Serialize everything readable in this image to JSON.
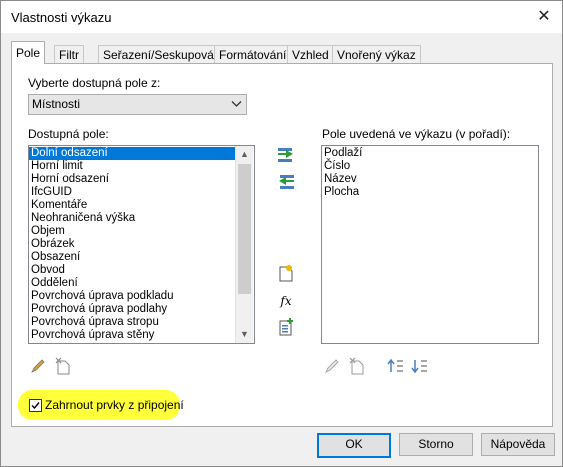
{
  "window": {
    "title": "Vlastnosti výkazu",
    "close_glyph": "✕"
  },
  "tabs": [
    {
      "label": "Pole",
      "active": true
    },
    {
      "label": "Filtr"
    },
    {
      "label": "Seřazení/Seskupování"
    },
    {
      "label": "Formátování"
    },
    {
      "label": "Vzhled"
    },
    {
      "label": "Vnořený výkaz"
    }
  ],
  "source": {
    "label": "Vyberte dostupná pole z:",
    "selected": "Místnosti"
  },
  "available": {
    "label": "Dostupná pole:",
    "items": [
      "Dolní odsazení",
      "Horní limit",
      "Horní odsazení",
      "IfcGUID",
      "Komentáře",
      "Neohraničená výška",
      "Objem",
      "Obrázek",
      "Obsazení",
      "Obvod",
      "Oddělení",
      "Povrchová úprava podkladu",
      "Povrchová úprava podlahy",
      "Povrchová úprava stropu",
      "Povrchová úprava stěny"
    ],
    "selected_index": 0
  },
  "scheduled": {
    "label": "Pole uvedená ve výkazu (v pořadí):",
    "items": [
      "Podlaží",
      "Číslo",
      "Název",
      "Plocha"
    ]
  },
  "middle_icons": [
    "add-field-icon",
    "remove-field-icon",
    "new-parameter-icon",
    "fx-icon",
    "combine-parameters-icon"
  ],
  "fx_glyph": "fx",
  "include_links": {
    "label": "Zahrnout prvky z připojení",
    "checked": true,
    "highlight_color": "#ffff3a"
  },
  "buttons": {
    "ok": "OK",
    "cancel": "Storno",
    "help": "Nápověda"
  },
  "colors": {
    "selection": "#0078d7",
    "accent": "#0078d7"
  }
}
